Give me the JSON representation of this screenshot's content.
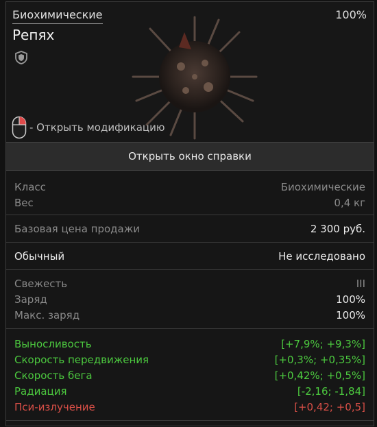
{
  "header": {
    "category": "Биохимические",
    "percent": "100%",
    "title": "Репях",
    "mod_hint": "- Открыть модификацию"
  },
  "help_button": {
    "label": "Открыть окно справки"
  },
  "info": [
    {
      "label": "Класс",
      "value": "Биохимические"
    },
    {
      "label": "Вес",
      "value": "0,4 кг"
    }
  ],
  "price": {
    "label": "Базовая цена продажи",
    "value": "2 300 руб."
  },
  "rarity": {
    "label": "Обычный",
    "value": "Не исследовано"
  },
  "condition": {
    "freshness": {
      "label": "Свежесть",
      "value": "III"
    },
    "charge": {
      "label": "Заряд",
      "value": "100%"
    },
    "max_charge": {
      "label": "Макс. заряд",
      "value": "100%"
    }
  },
  "stats": [
    {
      "label": "Выносливость",
      "value": "[+7,9%; +9,3%]",
      "color": "#4cc93f"
    },
    {
      "label": "Скорость передвижения",
      "value": "[+0,3%; +0,35%]",
      "color": "#4cc93f"
    },
    {
      "label": "Скорость бега",
      "value": "[+0,42%; +0,5%]",
      "color": "#4cc93f"
    },
    {
      "label": "Радиация",
      "value": "[-2,16; -1,84]",
      "color": "#4cc93f"
    },
    {
      "label": "Пси-излучение",
      "value": "[+0,42; +0,5]",
      "color": "#d94f47"
    }
  ],
  "icons": [
    "shield-icon",
    "mouse-icon",
    "artifact-image"
  ]
}
